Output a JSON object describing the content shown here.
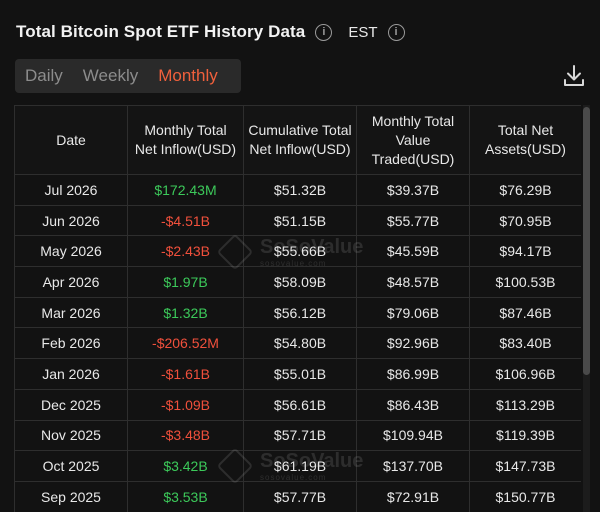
{
  "header": {
    "title": "Total Bitcoin Spot ETF History Data",
    "timezone": "EST"
  },
  "tabs": [
    {
      "label": "Daily",
      "active": false
    },
    {
      "label": "Weekly",
      "active": false
    },
    {
      "label": "Monthly",
      "active": true
    }
  ],
  "icons": {
    "info": "info-icon",
    "download": "download-icon"
  },
  "colors": {
    "accent": "#f0603c",
    "positive": "#3cc95a",
    "negative": "#f0503c",
    "background": "#121212"
  },
  "table": {
    "columns": {
      "date": "Date",
      "monthly_inflow": "Monthly Total Net Inflow(USD)",
      "cumulative_inflow": "Cumulative Total Net Inflow(USD)",
      "value_traded": "Monthly Total Value Traded(USD)",
      "net_assets": "Total Net Assets(USD)"
    },
    "rows": [
      {
        "date": "Jul 2026",
        "inflow": "$172.43M",
        "cumulative": "$51.32B",
        "traded": "$39.37B",
        "assets": "$76.29B"
      },
      {
        "date": "Jun 2026",
        "inflow": "-$4.51B",
        "cumulative": "$51.15B",
        "traded": "$55.77B",
        "assets": "$70.95B"
      },
      {
        "date": "May 2026",
        "inflow": "-$2.43B",
        "cumulative": "$55.66B",
        "traded": "$45.59B",
        "assets": "$94.17B"
      },
      {
        "date": "Apr 2026",
        "inflow": "$1.97B",
        "cumulative": "$58.09B",
        "traded": "$48.57B",
        "assets": "$100.53B"
      },
      {
        "date": "Mar 2026",
        "inflow": "$1.32B",
        "cumulative": "$56.12B",
        "traded": "$79.06B",
        "assets": "$87.46B"
      },
      {
        "date": "Feb 2026",
        "inflow": "-$206.52M",
        "cumulative": "$54.80B",
        "traded": "$92.96B",
        "assets": "$83.40B"
      },
      {
        "date": "Jan 2026",
        "inflow": "-$1.61B",
        "cumulative": "$55.01B",
        "traded": "$86.99B",
        "assets": "$106.96B"
      },
      {
        "date": "Dec 2025",
        "inflow": "-$1.09B",
        "cumulative": "$56.61B",
        "traded": "$86.43B",
        "assets": "$113.29B"
      },
      {
        "date": "Nov 2025",
        "inflow": "-$3.48B",
        "cumulative": "$57.71B",
        "traded": "$109.94B",
        "assets": "$119.39B"
      },
      {
        "date": "Oct 2025",
        "inflow": "$3.42B",
        "cumulative": "$61.19B",
        "traded": "$137.70B",
        "assets": "$147.73B"
      },
      {
        "date": "Sep 2025",
        "inflow": "$3.53B",
        "cumulative": "$57.77B",
        "traded": "$72.91B",
        "assets": "$150.77B"
      }
    ]
  },
  "watermark": {
    "brand": "SoSoValue",
    "domain": "sosovalue.com"
  }
}
